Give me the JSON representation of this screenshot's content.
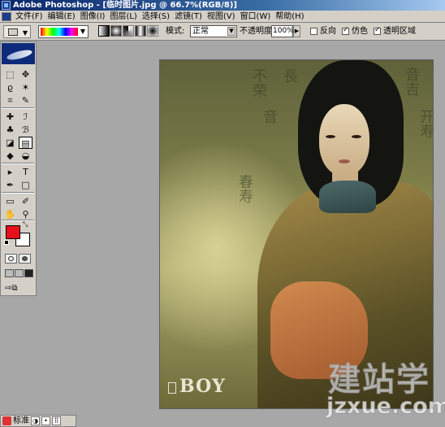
{
  "window": {
    "title": "Adobe Photoshop - [临时图片.jpg @ 66.7%(RGB/8)]"
  },
  "menubar": {
    "items": [
      "文件(F)",
      "编辑(E)",
      "图像(I)",
      "图层(L)",
      "选择(S)",
      "滤镜(T)",
      "视图(V)",
      "窗口(W)",
      "帮助(H)"
    ]
  },
  "options_bar": {
    "mode_label": "模式:",
    "mode_value": "正常",
    "opacity_label": "不透明度:",
    "opacity_value": "100%",
    "reverse_label": "反向",
    "reverse_checked": false,
    "dither_label": "仿色",
    "dither_checked": true,
    "transparency_label": "透明区域",
    "transparency_checked": true,
    "gradient_types": [
      "linear-gradient-icon",
      "radial-gradient-icon",
      "angle-gradient-icon",
      "reflected-gradient-icon",
      "diamond-gradient-icon"
    ]
  },
  "toolbox": {
    "tools": [
      {
        "name": "marquee-tool-icon",
        "glyph": "⬚"
      },
      {
        "name": "move-tool-icon",
        "glyph": "✥"
      },
      {
        "name": "lasso-tool-icon",
        "glyph": "ϱ"
      },
      {
        "name": "magic-wand-tool-icon",
        "glyph": "✶"
      },
      {
        "name": "crop-tool-icon",
        "glyph": "⌗"
      },
      {
        "name": "slice-tool-icon",
        "glyph": "✎"
      },
      {
        "name": "healing-brush-tool-icon",
        "glyph": "✚"
      },
      {
        "name": "brush-tool-icon",
        "glyph": "ℐ"
      },
      {
        "name": "clone-stamp-tool-icon",
        "glyph": "♣"
      },
      {
        "name": "history-brush-tool-icon",
        "glyph": "ℬ"
      },
      {
        "name": "eraser-tool-icon",
        "glyph": "◪"
      },
      {
        "name": "gradient-tool-icon",
        "glyph": "▤"
      },
      {
        "name": "blur-tool-icon",
        "glyph": "◆"
      },
      {
        "name": "dodge-tool-icon",
        "glyph": "◒"
      },
      {
        "name": "path-selection-tool-icon",
        "glyph": "▸"
      },
      {
        "name": "type-tool-icon",
        "glyph": "T"
      },
      {
        "name": "pen-tool-icon",
        "glyph": "✒"
      },
      {
        "name": "shape-tool-icon",
        "glyph": "□"
      },
      {
        "name": "notes-tool-icon",
        "glyph": "▭"
      },
      {
        "name": "eyedropper-tool-icon",
        "glyph": "✐"
      },
      {
        "name": "hand-tool-icon",
        "glyph": "✋"
      },
      {
        "name": "zoom-tool-icon",
        "glyph": "⚲"
      }
    ],
    "foreground_color": "#e8101a",
    "background_color": "#ffffff"
  },
  "canvas": {
    "calligraphy": [
      "不荣",
      "音吉",
      "开寿",
      "春寿",
      "長",
      "音"
    ],
    "logo_text": "BOY"
  },
  "watermark": {
    "main": "建站学",
    "sub": "jzxue.com"
  },
  "taskbar": {
    "ime_label": "标准",
    "ime_buttons": [
      "◑",
      "•",
      "⠿"
    ]
  }
}
